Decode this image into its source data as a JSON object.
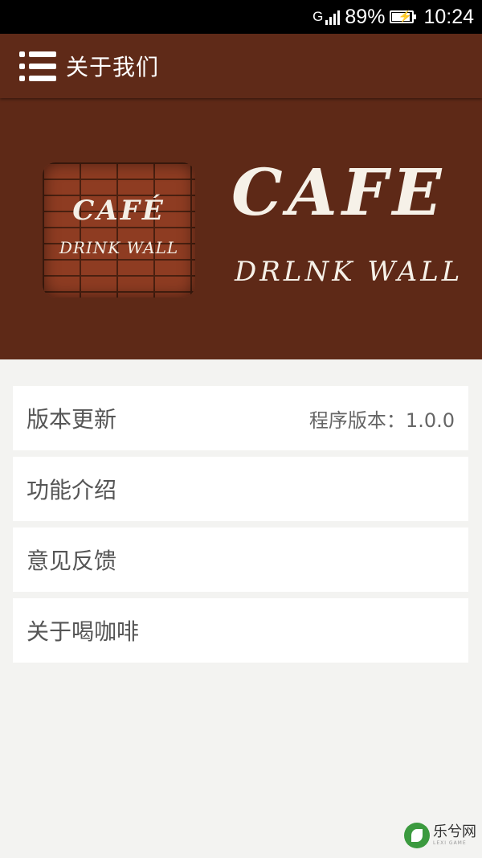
{
  "status_bar": {
    "network": "G",
    "battery_percent": "89%",
    "time": "10:24"
  },
  "app_bar": {
    "title": "关于我们",
    "menu_icon": "menu-list-icon"
  },
  "banner": {
    "logo_tile_title": "CAFÉ",
    "logo_tile_subtitle": "DRINK WALL",
    "big_title": "CAFE",
    "big_subtitle": "DRLNK WALL"
  },
  "menu": {
    "items": [
      {
        "label": "版本更新",
        "value": "程序版本：1.0.0"
      },
      {
        "label": "功能介绍",
        "value": ""
      },
      {
        "label": "意见反馈",
        "value": ""
      },
      {
        "label": "关于喝咖啡",
        "value": ""
      }
    ]
  },
  "watermark": {
    "main": "乐兮网",
    "sub": "LEXI GAME"
  },
  "colors": {
    "brand_brown": "#5f2a18",
    "background": "#f3f3f1"
  }
}
